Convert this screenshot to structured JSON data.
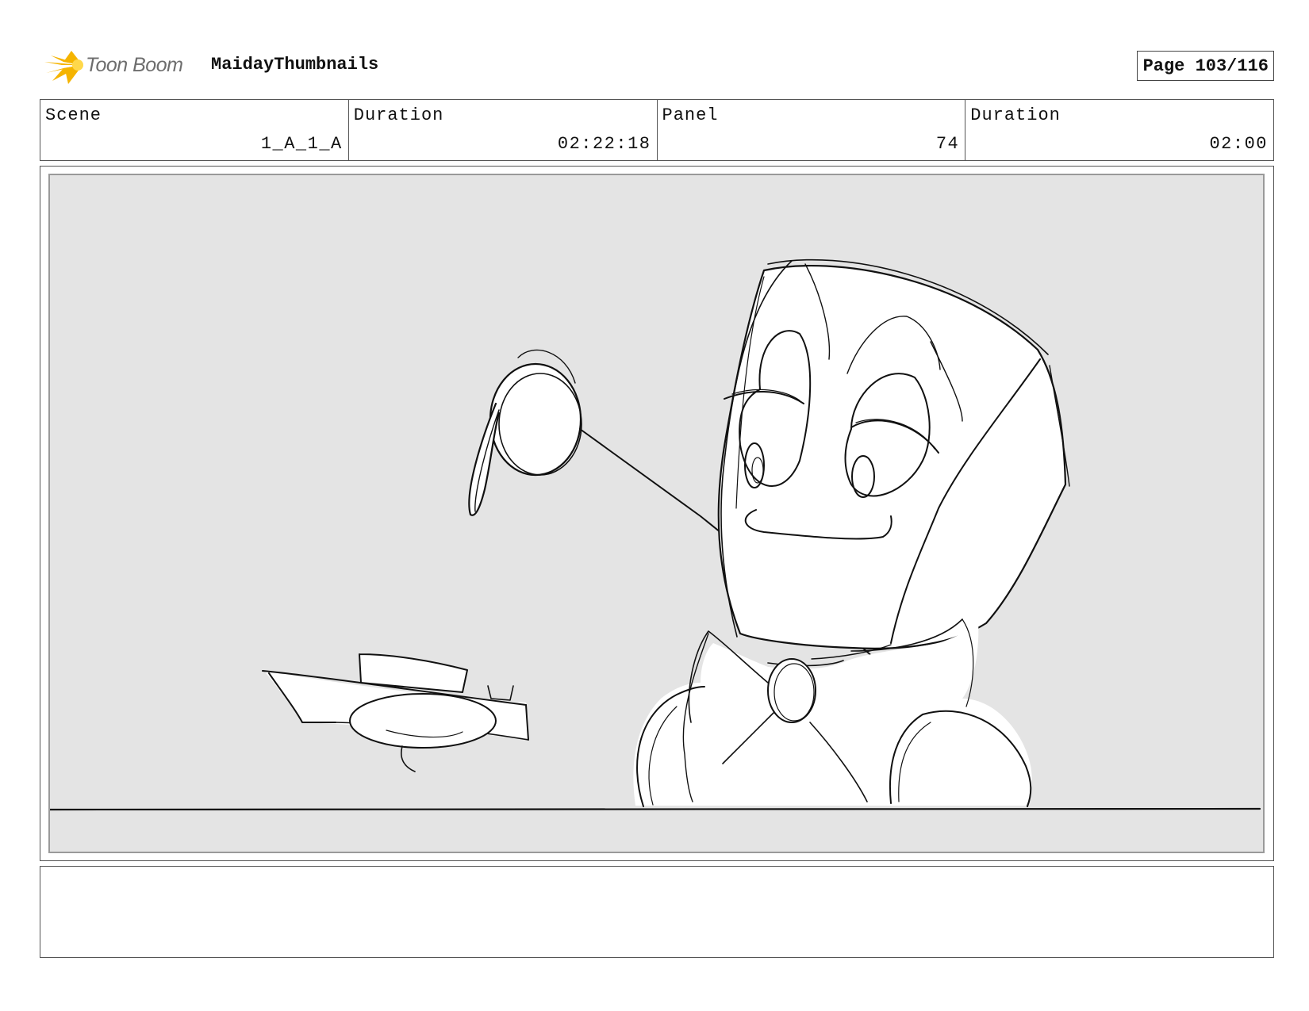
{
  "header": {
    "logo_text": "Toon Boom",
    "project_title": "MaidayThumbnails",
    "page_label": "Page 103/116"
  },
  "info": {
    "scene_label": "Scene",
    "scene_value": "1_A_1_A",
    "scene_duration_label": "Duration",
    "scene_duration_value": "02:22:18",
    "panel_label": "Panel",
    "panel_value": "74",
    "panel_duration_label": "Duration",
    "panel_duration_value": "02:00"
  },
  "notes": {
    "text": ""
  },
  "colors": {
    "logo_accent": "#f5b400",
    "canvas_background": "#e4e4e4",
    "sketch_line": "#111111"
  }
}
